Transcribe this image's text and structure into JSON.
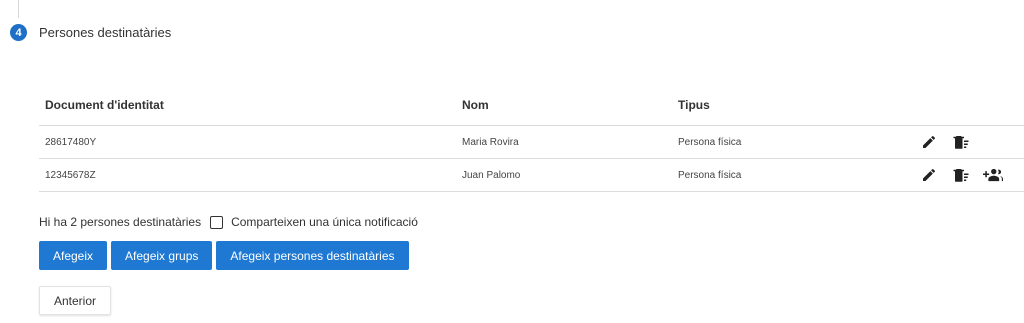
{
  "step": {
    "number": "4",
    "title": "Persones destinatàries"
  },
  "table": {
    "headers": {
      "document": "Document d'identitat",
      "name": "Nom",
      "type": "Tipus"
    },
    "rows": [
      {
        "document": "28617480Y",
        "name": "Maria Rovira",
        "type": "Persona física",
        "actions": [
          "edit-icon",
          "delete-list-icon"
        ]
      },
      {
        "document": "12345678Z",
        "name": "Juan Palomo",
        "type": "Persona física",
        "actions": [
          "edit-icon",
          "delete-list-icon",
          "add-group-icon"
        ]
      }
    ]
  },
  "summary": {
    "count_text": "Hi ha 2 persones destinatàries",
    "shared_label": "Comparteixen una única notificació",
    "shared_checked": false
  },
  "buttons": {
    "add": "Afegeix",
    "add_groups": "Afegeix grups",
    "add_recipients": "Afegeix persones destinatàries",
    "previous": "Anterior"
  },
  "colors": {
    "accent": "#1f78d1",
    "step_circle": "#1f6fc7"
  }
}
